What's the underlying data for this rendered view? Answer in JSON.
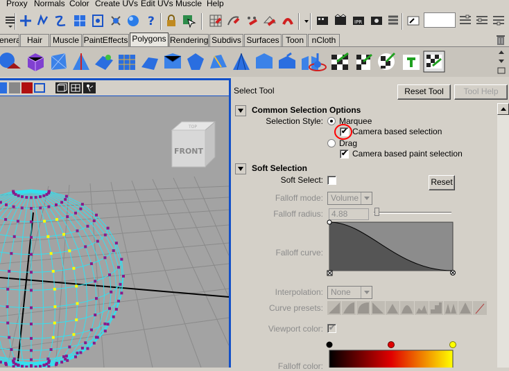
{
  "menubar": {
    "items": [
      "Proxy",
      "Normals",
      "Color",
      "Create UVs",
      "Edit UVs",
      "Muscle",
      "Help"
    ]
  },
  "shelf_tabs": [
    "eneral",
    "Hair",
    "Muscle",
    "PaintEffects",
    "Polygons",
    "Rendering",
    "Subdivs",
    "Surfaces",
    "Toon",
    "nCloth"
  ],
  "active_shelf_tab": "Polygons",
  "viewport": {
    "view_cube_label": "FRONT",
    "view_cube_top_label": "TOP"
  },
  "tool_settings": {
    "title": "Select Tool",
    "reset_button": "Reset Tool",
    "help_button": "Tool Help",
    "common": {
      "header": "Common Selection Options",
      "style_label": "Selection Style:",
      "marquee": "Marquee",
      "camera_based": "Camera based selection",
      "drag": "Drag",
      "camera_paint": "Camera based paint selection",
      "marquee_selected": true,
      "camera_based_checked": true,
      "camera_paint_checked": true
    },
    "soft": {
      "header": "Soft Selection",
      "soft_select_label": "Soft Select:",
      "reset_button": "Reset",
      "falloff_mode_label": "Falloff mode:",
      "falloff_mode_value": "Volume",
      "falloff_radius_label": "Falloff radius:",
      "falloff_radius_value": "4.88",
      "falloff_curve_label": "Falloff curve:",
      "interpolation_label": "Interpolation:",
      "interpolation_value": "None",
      "curve_presets_label": "Curve presets:",
      "viewport_color_label": "Viewport color:",
      "falloff_color_label": "Falloff color:"
    }
  },
  "colors": {
    "viewport_bg": "#a3a3a3",
    "wireframe": "#33e0f0",
    "selected_vertex": "#ffff00",
    "vertex": "#8a1a8a",
    "highlight_circle": "#ff0000",
    "panel_border": "#1250c8"
  }
}
